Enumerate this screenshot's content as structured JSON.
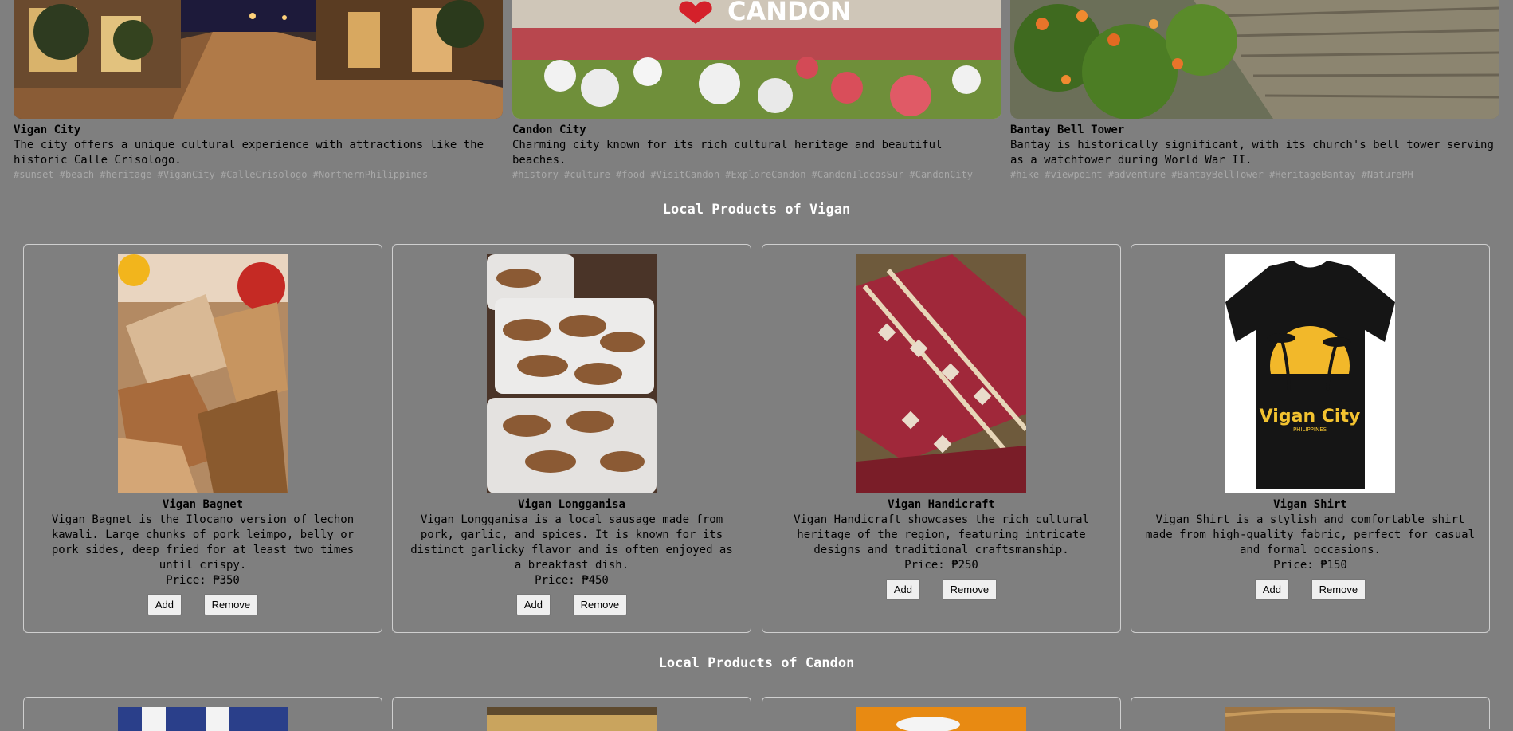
{
  "destinations": [
    {
      "title": "Vigan City",
      "description": "The city offers a unique cultural experience with attractions like the historic Calle Crisologo.",
      "tags": "#sunset #beach #heritage #ViganCity #CalleCrisologo #NorthernPhilippines"
    },
    {
      "title": "Candon City",
      "description": "Charming city known for its rich cultural heritage and beautiful beaches.",
      "tags": "#history #culture #food #VisitCandon #ExploreCandon #CandonIlocosSur #CandonCity",
      "sign_text": "CANDON"
    },
    {
      "title": "Bantay Bell Tower",
      "description": "Bantay is historically significant, with its church's bell tower serving as a watchtower during World War II.",
      "tags": "#hike #viewpoint #adventure #BantayBellTower #HeritageBantay #NaturePH"
    }
  ],
  "sections": {
    "vigan_title": "Local Products of Vigan",
    "candon_title": "Local Products of Candon"
  },
  "products": [
    {
      "name": "Vigan Bagnet",
      "description": "Vigan Bagnet is the Ilocano version of lechon kawali. Large chunks of pork leimpo, belly or pork sides, deep fried for at least two times until crispy.",
      "price": "Price: ₱350"
    },
    {
      "name": "Vigan Longganisa",
      "description": "Vigan Longganisa is a local sausage made from pork, garlic, and spices. It is known for its distinct garlicky flavor and is often enjoyed as a breakfast dish.",
      "price": "Price: ₱450"
    },
    {
      "name": "Vigan Handicraft",
      "description": "Vigan Handicraft showcases the rich cultural heritage of the region, featuring intricate designs and traditional craftsmanship.",
      "price": "Price: ₱250"
    },
    {
      "name": "Vigan Shirt",
      "description": "Vigan Shirt is a stylish and comfortable shirt made from high-quality fabric, perfect for casual and formal occasions.",
      "price": "Price: ₱150",
      "shirt_print": "Vigan City",
      "shirt_subprint": "PHILIPPINES"
    }
  ],
  "buttons": {
    "add": "Add",
    "remove": "Remove"
  },
  "colors": {
    "background": "#7f7f7f",
    "section_title": "#ffffff",
    "tags": "#a8a8a8"
  }
}
